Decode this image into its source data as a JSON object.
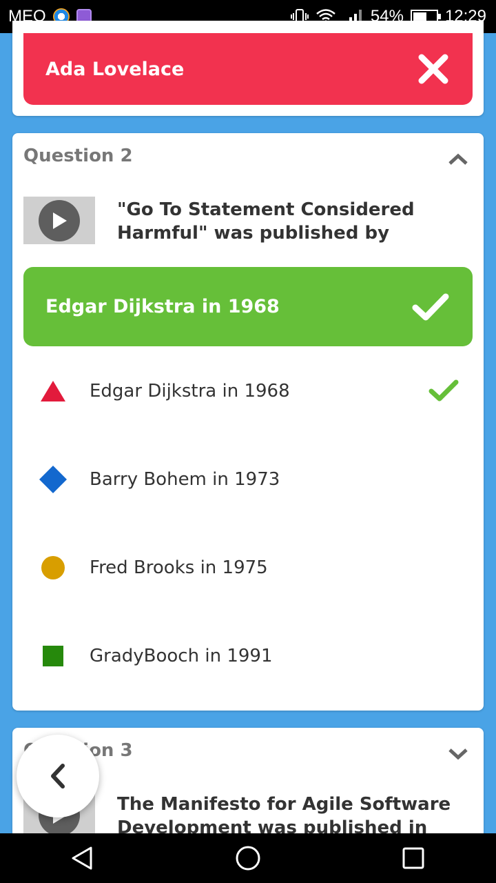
{
  "status_bar": {
    "carrier": "MEO",
    "battery_percent": "54%",
    "battery_level": 0.54,
    "time": "12:29"
  },
  "top_card": {
    "answer_label": "Ada Lovelace",
    "answer_icon": "close-icon",
    "answer_color": "#f2324f"
  },
  "question2": {
    "header": "Question 2",
    "text": "\"Go To Statement Considered Harmful\" was published by",
    "selected_answer": "Edgar Dijkstra in 1968",
    "selected_color": "#66bf39",
    "options": [
      {
        "label": "Edgar Dijkstra in 1968",
        "shape": "triangle-icon",
        "color": "#e21b3c",
        "correct": true
      },
      {
        "label": "Barry Bohem in 1973",
        "shape": "diamond-icon",
        "color": "#1368ce",
        "correct": false
      },
      {
        "label": "Fred Brooks in 1975",
        "shape": "circle-icon",
        "color": "#d89e00",
        "correct": false
      },
      {
        "label": "GradyBooch in 1991",
        "shape": "square-icon",
        "color": "#26890c",
        "correct": false
      }
    ]
  },
  "question3": {
    "header": "Question 3",
    "text": "The Manifesto for Agile Software Development was published in"
  }
}
